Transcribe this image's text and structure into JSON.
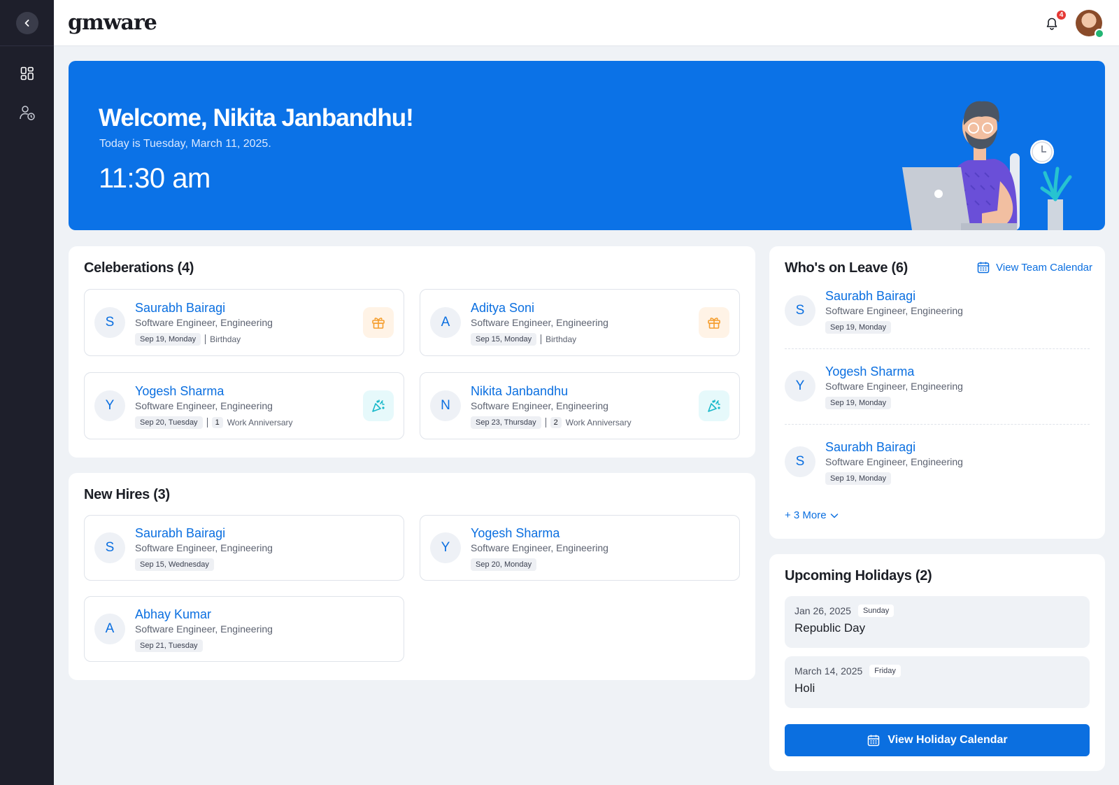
{
  "app": {
    "logo": "gmware"
  },
  "header": {
    "notification_count": "4"
  },
  "banner": {
    "welcome": "Welcome, Nikita Janbandhu!",
    "today": "Today is Tuesday, March 11, 2025.",
    "time": "11:30 am"
  },
  "celebrations": {
    "title": "Celeberations (4)",
    "items": [
      {
        "initial": "S",
        "name": "Saurabh Bairagi",
        "role": "Software Engineer, Engineering",
        "date": "Sep 19, Monday",
        "type": "Birthday",
        "years": ""
      },
      {
        "initial": "A",
        "name": "Aditya Soni",
        "role": "Software Engineer, Engineering",
        "date": "Sep 15, Monday",
        "type": "Birthday",
        "years": ""
      },
      {
        "initial": "Y",
        "name": "Yogesh Sharma",
        "role": "Software Engineer, Engineering",
        "date": "Sep 20, Tuesday",
        "type": "Work Anniversary",
        "years": "1"
      },
      {
        "initial": "N",
        "name": "Nikita Janbandhu",
        "role": "Software Engineer, Engineering",
        "date": "Sep 23, Thursday",
        "type": "Work Anniversary",
        "years": "2"
      }
    ]
  },
  "new_hires": {
    "title": "New Hires (3)",
    "items": [
      {
        "initial": "S",
        "name": "Saurabh Bairagi",
        "role": "Software Engineer, Engineering",
        "date": "Sep 15, Wednesday"
      },
      {
        "initial": "Y",
        "name": "Yogesh Sharma",
        "role": "Software Engineer, Engineering",
        "date": "Sep 20, Monday"
      },
      {
        "initial": "A",
        "name": "Abhay Kumar",
        "role": "Software Engineer, Engineering",
        "date": "Sep 21, Tuesday"
      }
    ]
  },
  "leave": {
    "title": "Who's on Leave (6)",
    "team_calendar_label": "View Team Calendar",
    "items": [
      {
        "initial": "S",
        "name": "Saurabh Bairagi",
        "role": "Software Engineer, Engineering",
        "date": "Sep 19, Monday"
      },
      {
        "initial": "Y",
        "name": "Yogesh Sharma",
        "role": "Software Engineer, Engineering",
        "date": "Sep 19, Monday"
      },
      {
        "initial": "S",
        "name": "Saurabh Bairagi",
        "role": "Software Engineer, Engineering",
        "date": "Sep 19, Monday"
      }
    ],
    "more_label": "+ 3 More"
  },
  "holidays": {
    "title": "Upcoming Holidays (2)",
    "items": [
      {
        "date": "Jan 26, 2025",
        "day": "Sunday",
        "name": "Republic Day"
      },
      {
        "date": "March 14, 2025",
        "day": "Friday",
        "name": "Holi"
      }
    ],
    "button_label": "View Holiday Calendar"
  },
  "colors": {
    "accent": "#0b6fe0",
    "banner": "#0b72e7",
    "sidebar": "#1e1f2b"
  }
}
